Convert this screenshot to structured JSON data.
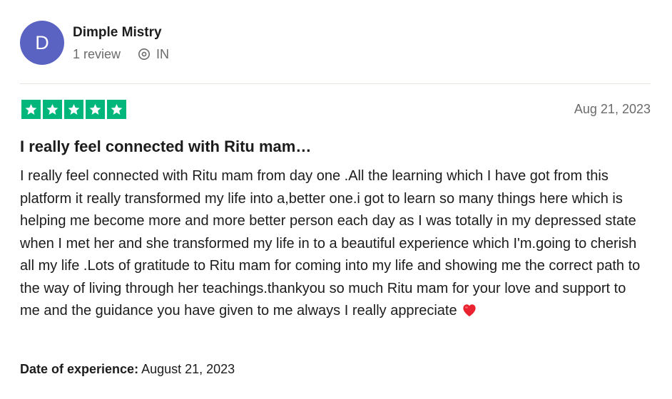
{
  "consumer": {
    "avatar_initial": "D",
    "avatar_color": "#5a62c2",
    "name": "Dimple Mistry",
    "review_count": "1 review",
    "location_icon": "location-pin-icon",
    "country": "IN"
  },
  "review": {
    "rating": 5,
    "rating_max": 5,
    "star_color": "#00b67a",
    "date": "Aug 21, 2023",
    "title": "I really feel connected with Ritu mam…",
    "body": "I really feel connected with Ritu mam from day one .All the learning which I have got from this platform it really transformed my life into a,better one.i got to learn so many things here which is helping me become more and more better person each day as I was totally in my depressed state when I met her and she transformed my life in to a beautiful experience which I'm.going to cherish all my life .Lots of gratitude to Ritu mam for coming into my life and showing me the correct path to the way of living through her teachings.thankyou so much Ritu mam for your love and support to me and the guidance you have given to me always I really appreciate",
    "body_emoji": "heart-icon",
    "experience_label": "Date of experience:",
    "experience_date": "August 21, 2023"
  }
}
